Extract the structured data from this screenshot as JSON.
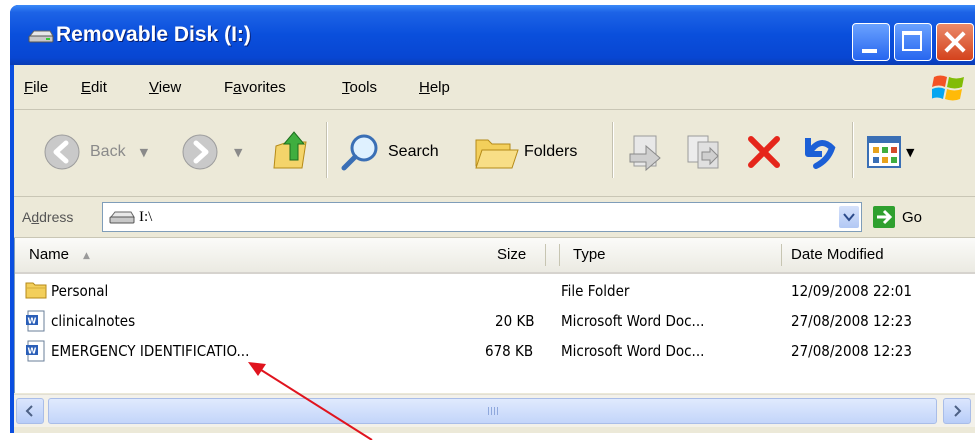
{
  "window": {
    "title": "Removable Disk (I:)"
  },
  "menu": {
    "items": [
      {
        "key": "F",
        "rest": "ile",
        "label": "File"
      },
      {
        "key": "E",
        "rest": "dit",
        "label": "Edit"
      },
      {
        "key": "V",
        "rest": "iew",
        "label": "View"
      },
      {
        "key": "a",
        "pre": "F",
        "rest": "vorites",
        "label": "Favorites"
      },
      {
        "key": "T",
        "rest": "ools",
        "label": "Tools"
      },
      {
        "key": "H",
        "rest": "elp",
        "label": "Help"
      }
    ]
  },
  "toolbar": {
    "back_label": "Back",
    "search_label": "Search",
    "folders_label": "Folders"
  },
  "address": {
    "label": "Address",
    "value": "I:\\",
    "go_label": "Go"
  },
  "columns": [
    "Name",
    "Size",
    "Type",
    "Date Modified"
  ],
  "files": [
    {
      "name": "Personal",
      "size": "",
      "type": "File Folder",
      "date": "12/09/2008 22:01",
      "icon": "folder-icon"
    },
    {
      "name": "clinicalnotes",
      "size": "20 KB",
      "type": "Microsoft Word Doc...",
      "date": "27/08/2008 12:23",
      "icon": "word-document-icon"
    },
    {
      "name": "EMERGENCY IDENTIFICATIO...",
      "size": "678 KB",
      "type": "Microsoft Word Doc...",
      "date": "27/08/2008 12:23",
      "icon": "word-document-icon"
    }
  ],
  "colors": {
    "titlebar": "#0a4fdc",
    "client": "#ece9d8",
    "annotation_arrow": "#e0141e"
  }
}
